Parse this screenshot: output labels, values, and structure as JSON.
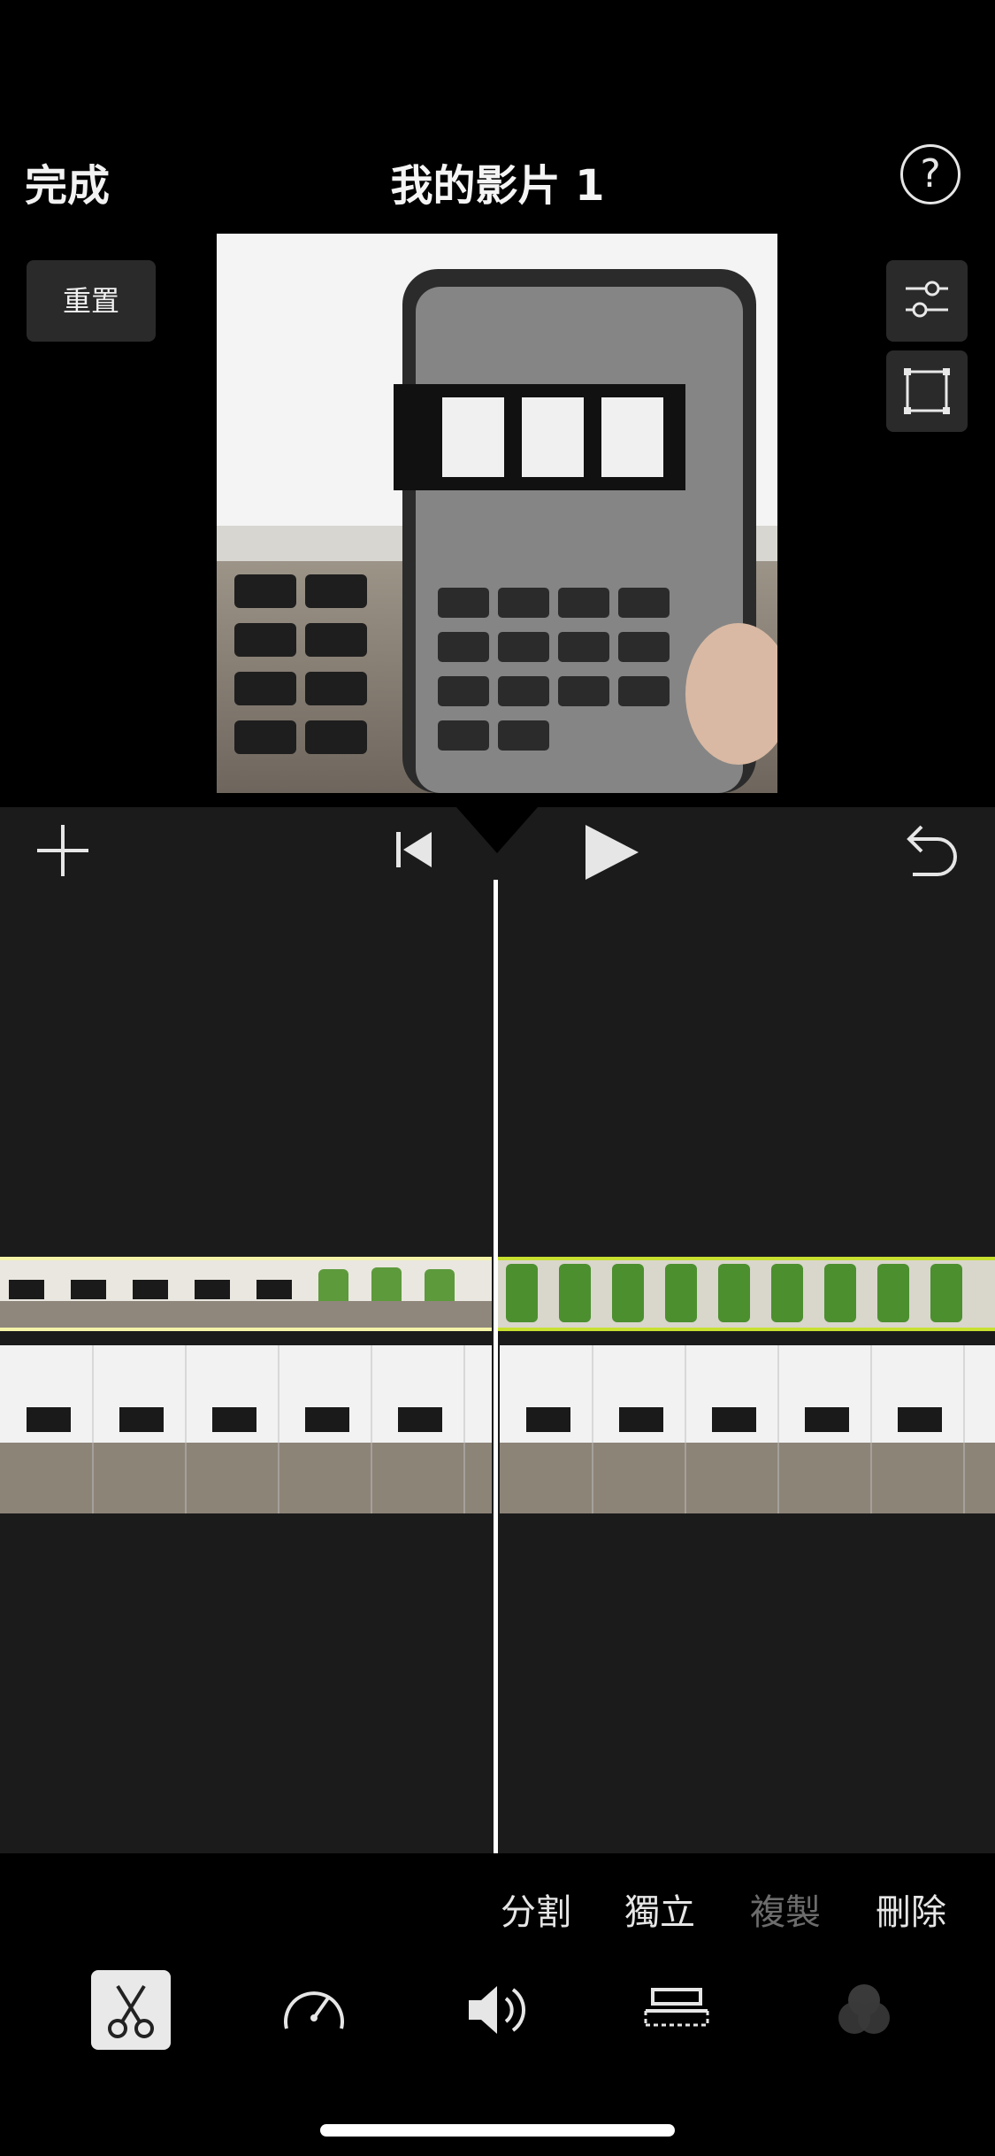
{
  "header": {
    "done_label": "完成",
    "title": "我的影片 1",
    "help_label": "?"
  },
  "viewer": {
    "reset_label": "重置"
  },
  "timeline": {
    "actions": {
      "split_label": "分割",
      "detach_label": "獨立",
      "duplicate_label": "複製",
      "delete_label": "刪除"
    }
  },
  "toolbar": {
    "tools": [
      "scissors-icon",
      "speedometer-icon",
      "speaker-icon",
      "titles-icon",
      "filters-icon"
    ],
    "selected": "scissors-icon"
  },
  "colors": {
    "accent_yellow": "#f5f3a8",
    "accent_green": "#c8e030",
    "background": "#000000",
    "timeline_bg": "#1b1b1b",
    "disabled_text": "#6c6c6c"
  }
}
